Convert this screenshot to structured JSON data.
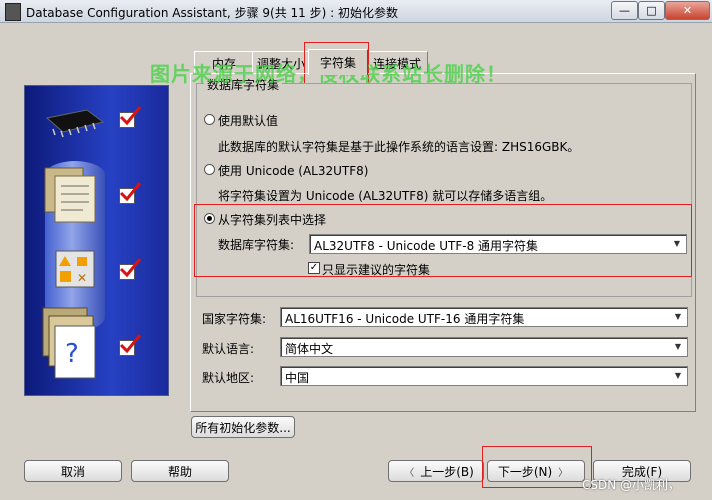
{
  "window": {
    "title": "Database Configuration Assistant, 步骤 9(共 11 步) : 初始化参数",
    "minimize": "—",
    "maximize": "□",
    "close": "✕"
  },
  "tabs": [
    {
      "label": "内存",
      "active": false
    },
    {
      "label": "调整大小",
      "active": false
    },
    {
      "label": "字符集",
      "active": true
    },
    {
      "label": "连接模式",
      "active": false
    }
  ],
  "charset_group": {
    "title": "数据库字符集",
    "option_default": "使用默认值",
    "option_default_desc": "此数据库的默认字符集是基于此操作系统的语言设置: ZHS16GBK。",
    "option_unicode": "使用 Unicode (AL32UTF8)",
    "option_unicode_desc": "将字符集设置为 Unicode (AL32UTF8) 就可以存储多语言组。",
    "option_list": "从字符集列表中选择",
    "selected_option": "option_list",
    "db_charset_label": "数据库字符集:",
    "db_charset_value": "AL32UTF8 - Unicode UTF-8 通用字符集",
    "recommended_only_label": "只显示建议的字符集",
    "recommended_only_checked": true
  },
  "national_charset": {
    "label": "国家字符集:",
    "value": "AL16UTF16 - Unicode UTF-16 通用字符集"
  },
  "default_language": {
    "label": "默认语言:",
    "value": "简体中文"
  },
  "default_territory": {
    "label": "默认地区:",
    "value": "中国"
  },
  "all_params_button": "所有初始化参数...",
  "footer": {
    "cancel": "取消",
    "help": "帮助",
    "back": "上一步(B)",
    "next": "下一步(N)",
    "finish": "完成(F)"
  },
  "watermark": "图片来源于网络，侵权联系站长删除！",
  "credit": "CSDN @小凯利，",
  "accent_colors": {
    "highlight": "#e02020",
    "watermark": "#3fd23f",
    "panel": "#1a2a9c"
  }
}
